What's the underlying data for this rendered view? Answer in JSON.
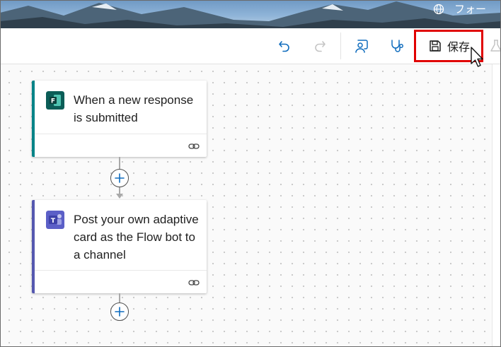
{
  "header": {
    "environment_label": "フォー",
    "icons": [
      "globe-icon"
    ]
  },
  "toolbar": {
    "icons": [
      "undo-icon",
      "redo-icon",
      "copilot-icon",
      "flow-checker-icon",
      "save-icon",
      "test-icon"
    ],
    "save_label": "保存"
  },
  "flow": {
    "steps": [
      {
        "title": "When a new response is submitted",
        "icon": "forms-icon",
        "accent_color": "#038387"
      },
      {
        "title": "Post your own adaptive card as the Flow bot to a channel",
        "icon": "teams-icon",
        "accent_color": "#5558af"
      }
    ]
  },
  "colors": {
    "highlight": "#e00000",
    "icon_blue": "#0f6cbd"
  }
}
